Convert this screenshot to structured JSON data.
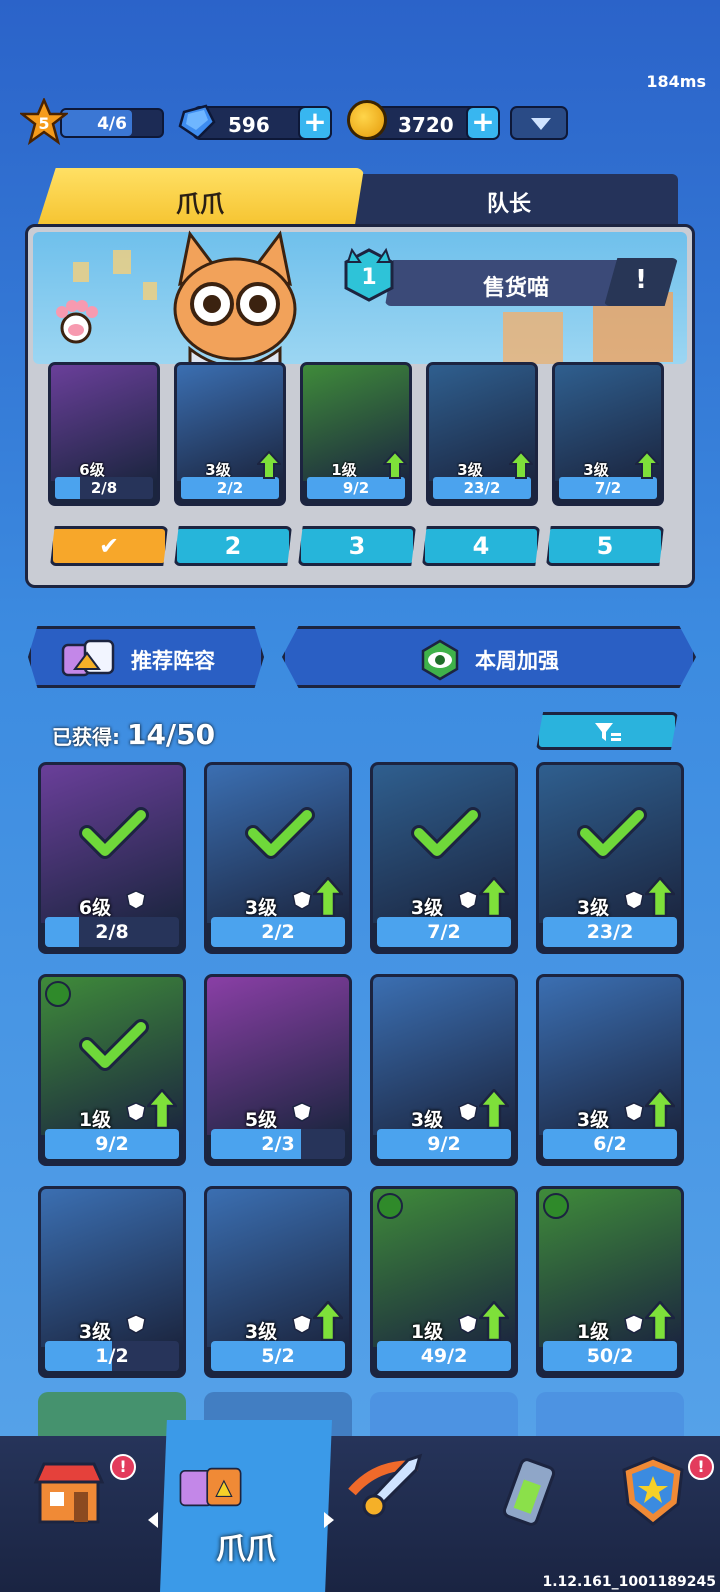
{
  "status": {
    "ping": "184ms"
  },
  "player": {
    "level": "5",
    "xp_text": "4/6"
  },
  "currency": {
    "gems": "596",
    "coins": "3720"
  },
  "tabs": [
    {
      "label": "爪爪"
    },
    {
      "label": "队长"
    }
  ],
  "captain": {
    "slot_number": "1",
    "name": "售货喵",
    "info_icon": "!"
  },
  "squad": [
    {
      "level": "6级",
      "count": "2/8",
      "progress": 0.25,
      "upgradable": false
    },
    {
      "level": "3级",
      "count": "2/2",
      "progress": 1.0,
      "upgradable": true
    },
    {
      "level": "1级",
      "count": "9/2",
      "progress": 1.0,
      "upgradable": true
    },
    {
      "level": "3级",
      "count": "23/2",
      "progress": 1.0,
      "upgradable": true
    },
    {
      "level": "3级",
      "count": "7/2",
      "progress": 1.0,
      "upgradable": true
    }
  ],
  "lineup_slots": [
    {
      "label": "✔"
    },
    {
      "label": "2"
    },
    {
      "label": "3"
    },
    {
      "label": "4"
    },
    {
      "label": "5"
    }
  ],
  "actions": {
    "recommended": "推荐阵容",
    "weekly_buff": "本周加强"
  },
  "collection": {
    "label": "已获得:",
    "count": "14/50"
  },
  "cards": [
    {
      "level": "6级",
      "count": "2/8",
      "progress": 0.25,
      "in_squad": true,
      "upgradable": false,
      "color": "#6a3f9a"
    },
    {
      "level": "3级",
      "count": "2/2",
      "progress": 1.0,
      "in_squad": true,
      "upgradable": true,
      "color": "#3b6fb2"
    },
    {
      "level": "3级",
      "count": "7/2",
      "progress": 1.0,
      "in_squad": true,
      "upgradable": true,
      "color": "#2f5f8f"
    },
    {
      "level": "3级",
      "count": "23/2",
      "progress": 1.0,
      "in_squad": true,
      "upgradable": true,
      "color": "#2f5f8f"
    },
    {
      "level": "1级",
      "count": "9/2",
      "progress": 1.0,
      "in_squad": true,
      "upgradable": true,
      "color": "#3f8b3a"
    },
    {
      "level": "5级",
      "count": "2/3",
      "progress": 0.67,
      "in_squad": false,
      "upgradable": false,
      "color": "#8a3fa6"
    },
    {
      "level": "3级",
      "count": "9/2",
      "progress": 1.0,
      "in_squad": false,
      "upgradable": true,
      "color": "#3b6fb2"
    },
    {
      "level": "3级",
      "count": "6/2",
      "progress": 1.0,
      "in_squad": false,
      "upgradable": true,
      "color": "#3b6fb2"
    },
    {
      "level": "3级",
      "count": "1/2",
      "progress": 0.5,
      "in_squad": false,
      "upgradable": false,
      "color": "#3b6fb2"
    },
    {
      "level": "3级",
      "count": "5/2",
      "progress": 1.0,
      "in_squad": false,
      "upgradable": true,
      "color": "#3b6fb2"
    },
    {
      "level": "1级",
      "count": "49/2",
      "progress": 1.0,
      "in_squad": false,
      "upgradable": true,
      "color": "#3f8b3a"
    },
    {
      "level": "1级",
      "count": "50/2",
      "progress": 1.0,
      "in_squad": false,
      "upgradable": true,
      "color": "#3f8b3a"
    }
  ],
  "nav": {
    "active_label": "爪爪",
    "alert_mark": "!"
  },
  "build": {
    "version": "1.12.161_1001189245"
  }
}
